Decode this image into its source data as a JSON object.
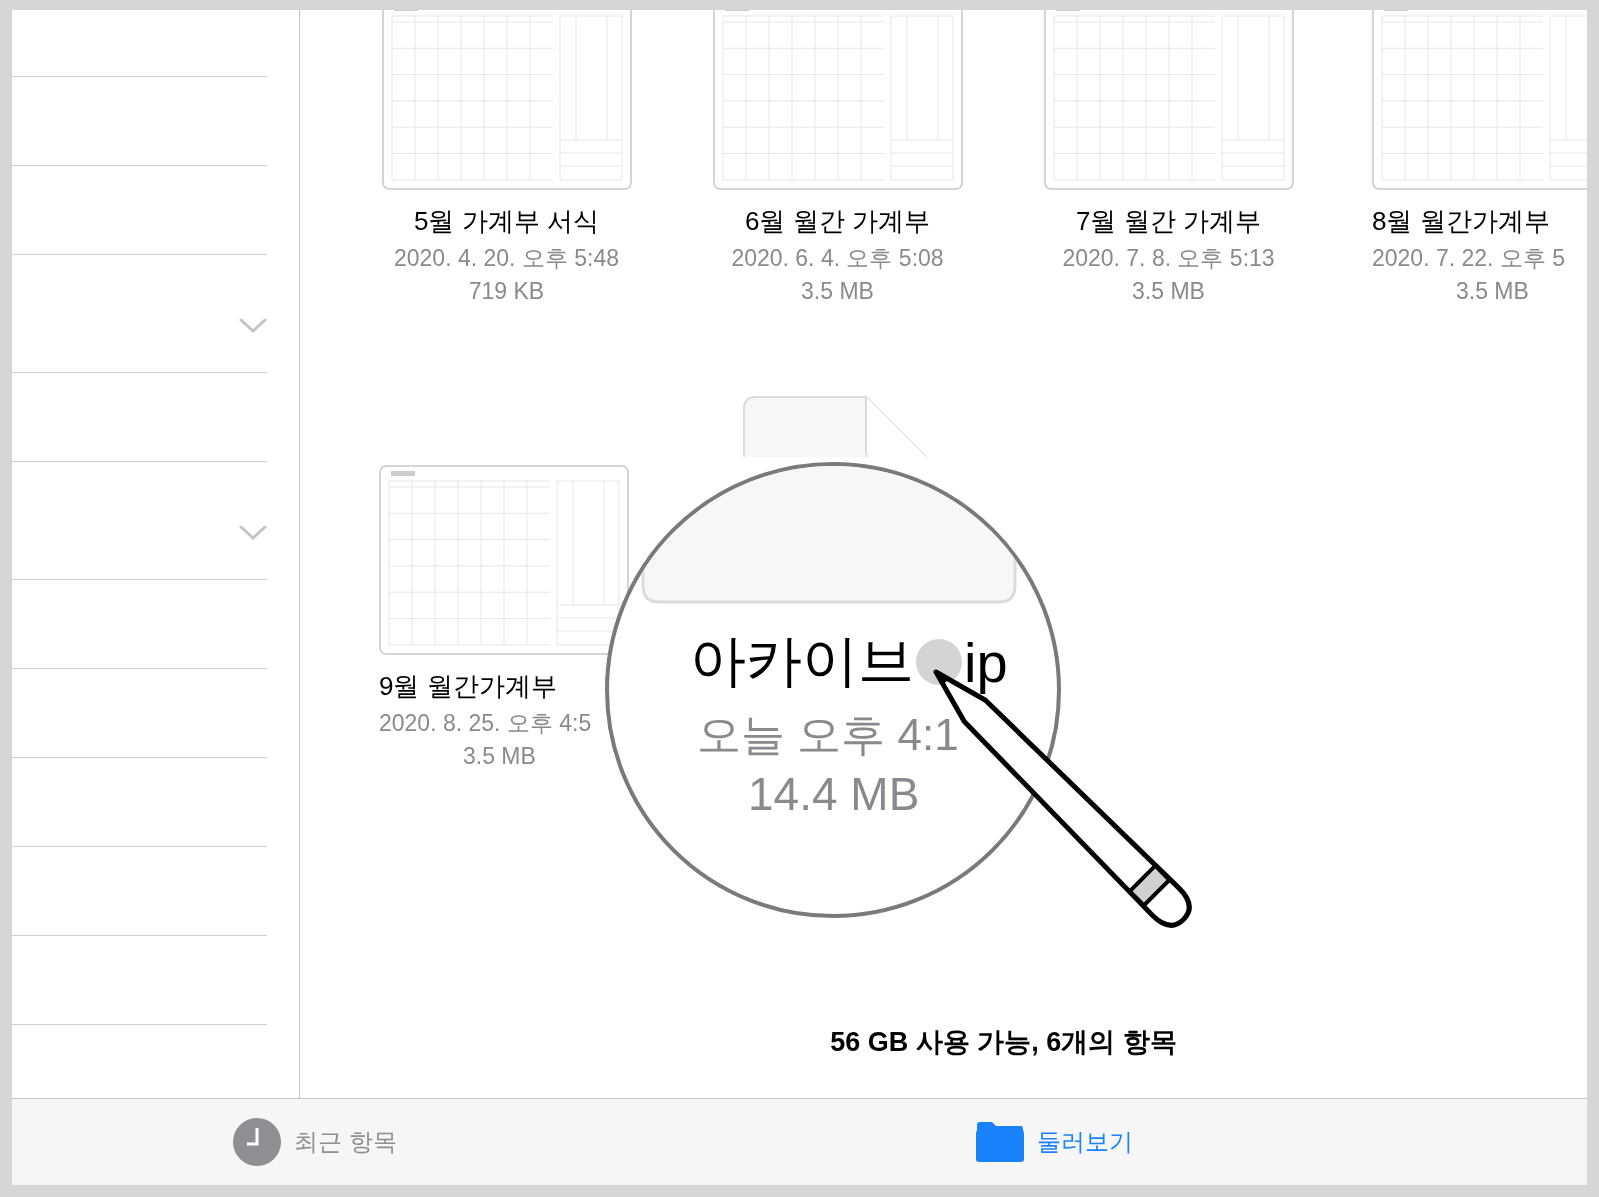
{
  "sidebar": {
    "rows": [
      {
        "expandable": false
      },
      {
        "expandable": false
      },
      {
        "expandable": false
      },
      {
        "expandable": true
      },
      {
        "expandable": false
      },
      {
        "expandable": true
      },
      {
        "expandable": false
      },
      {
        "expandable": false
      },
      {
        "expandable": false
      },
      {
        "expandable": false
      },
      {
        "expandable": false
      }
    ]
  },
  "files": [
    {
      "kind": "calendar",
      "name": "5월 가계부 서식",
      "date": "2020. 4. 20. 오후 5:48",
      "size": "719 KB"
    },
    {
      "kind": "calendar",
      "name": "6월 월간 가계부",
      "date": "2020. 6. 4. 오후 5:08",
      "size": "3.5 MB"
    },
    {
      "kind": "calendar",
      "name": "7월 월간 가계부",
      "date": "2020. 7. 8. 오후 5:13",
      "size": "3.5 MB"
    },
    {
      "kind": "calendar",
      "name": "8월 월간가계부",
      "date": "2020. 7. 22. 오후 5",
      "size": "3.5 MB"
    },
    {
      "kind": "calendar",
      "name": "9월 월간가계부",
      "date": "2020. 8. 25. 오후 4:5",
      "size": "3.5 MB"
    },
    {
      "kind": "archive"
    }
  ],
  "magnifier": {
    "name_start": "아카이브",
    "name_end": "ip",
    "date": "오늘 오후 4:1",
    "size": "14.4 MB"
  },
  "status": "56 GB 사용 가능, 6개의 항목",
  "tabs": [
    {
      "kind": "recents",
      "label": "최근 항목",
      "selected": false
    },
    {
      "kind": "browse",
      "label": "둘러보기",
      "selected": true
    }
  ]
}
